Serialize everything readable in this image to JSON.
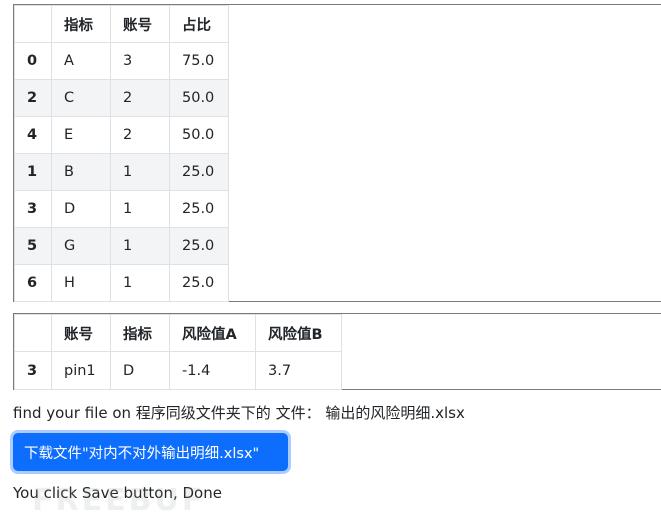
{
  "table1": {
    "headers": [
      "",
      "指标",
      "账号",
      "占比"
    ],
    "rows": [
      {
        "index": "0",
        "cells": [
          "A",
          "3",
          "75.0"
        ]
      },
      {
        "index": "2",
        "cells": [
          "C",
          "2",
          "50.0"
        ]
      },
      {
        "index": "4",
        "cells": [
          "E",
          "2",
          "50.0"
        ]
      },
      {
        "index": "1",
        "cells": [
          "B",
          "1",
          "25.0"
        ]
      },
      {
        "index": "3",
        "cells": [
          "D",
          "1",
          "25.0"
        ]
      },
      {
        "index": "5",
        "cells": [
          "G",
          "1",
          "25.0"
        ]
      },
      {
        "index": "6",
        "cells": [
          "H",
          "1",
          "25.0"
        ]
      }
    ]
  },
  "table2": {
    "headers": [
      "",
      "账号",
      "指标",
      "风险值A",
      "风险值B"
    ],
    "rows": [
      {
        "index": "3",
        "cells": [
          "pin1",
          "D",
          "-1.4",
          "3.7"
        ]
      }
    ]
  },
  "info_text": "find your file on 程序同级文件夹下的 文件： 输出的风险明细.xlsx",
  "download_button_label": "下载文件\"对内不对外输出明细.xlsx\"",
  "status_text": "You click Save button, Done",
  "watermark_text": "FREEBUF",
  "colors": {
    "button_bg": "#0d6efd",
    "button_text": "#ffffff",
    "stripe": "#f3f4f6",
    "border": "#dee2e6"
  }
}
